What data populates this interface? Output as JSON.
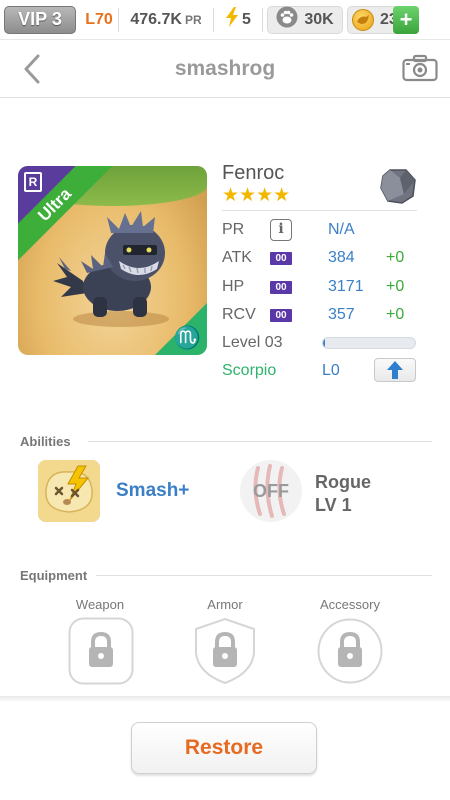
{
  "topbar": {
    "vip": "VIP 3",
    "level": "L70",
    "power": "476.7K",
    "power_unit": "PR",
    "energy": "5",
    "paws": "30K",
    "coins": "23",
    "add_label": "+"
  },
  "header": {
    "title": "smashrog"
  },
  "monster": {
    "name": "Fenroc",
    "stars": "★★★★",
    "star_count": 4,
    "rarity": "Ultra",
    "rank_badge": "R",
    "zodiac_symbol": "♏",
    "stats": [
      {
        "label": "PR",
        "value": "N/A",
        "bonus": ""
      },
      {
        "label": "ATK",
        "tag": "00",
        "value": "384",
        "bonus": "+0"
      },
      {
        "label": "HP",
        "tag": "00",
        "value": "3171",
        "bonus": "+0"
      },
      {
        "label": "RCV",
        "tag": "00",
        "value": "357",
        "bonus": "+0"
      }
    ],
    "level_label": "Level 03",
    "level_progress": 0.02,
    "zodiac_name": "Scorpio",
    "zodiac_level": "L0"
  },
  "abilities": {
    "section_label": "Abilities",
    "active_name": "Smash+",
    "passive_status": "OFF",
    "passive_name": "Rogue",
    "passive_level": "LV 1"
  },
  "equipment": {
    "section_label": "Equipment",
    "slots": [
      "Weapon",
      "Armor",
      "Accessory"
    ]
  },
  "footer": {
    "restore_label": "Restore"
  },
  "colors": {
    "accent_blue": "#3a7fc8",
    "bonus_green": "#3aab3a",
    "restore_orange": "#e76a20",
    "ultra_green": "#3dae3a",
    "zodiac_green": "#2cb36b"
  }
}
